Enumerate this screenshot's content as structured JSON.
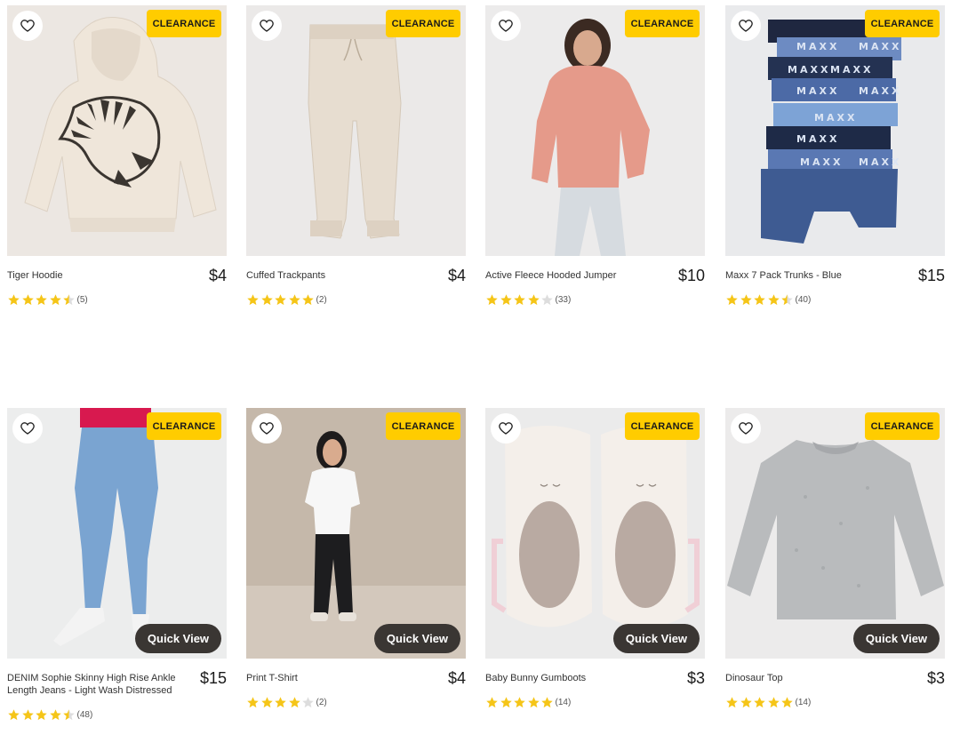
{
  "badge_label": "CLEARANCE",
  "quick_view_label": "Quick View",
  "colors": {
    "badge": "#ffcc00",
    "star": "#f5c518",
    "quick_view": "#3a3633"
  },
  "products": [
    {
      "name": "Tiger Hoodie",
      "price": "$4",
      "rating": 4.5,
      "count": "(5)",
      "quick_view": false
    },
    {
      "name": "Cuffed Trackpants",
      "price": "$4",
      "rating": 5,
      "count": "(2)",
      "quick_view": false
    },
    {
      "name": "Active Fleece Hooded Jumper",
      "price": "$10",
      "rating": 4,
      "count": "(33)",
      "quick_view": false
    },
    {
      "name": "Maxx 7 Pack Trunks - Blue",
      "price": "$15",
      "rating": 4.5,
      "count": "(40)",
      "quick_view": false
    },
    {
      "name": "DENIM Sophie Skinny High Rise Ankle Length Jeans - Light Wash Distressed",
      "price": "$15",
      "rating": 4.5,
      "count": "(48)",
      "quick_view": true
    },
    {
      "name": "Print T-Shirt",
      "price": "$4",
      "rating": 4,
      "count": "(2)",
      "quick_view": true
    },
    {
      "name": "Baby Bunny Gumboots",
      "price": "$3",
      "rating": 5,
      "count": "(14)",
      "quick_view": true
    },
    {
      "name": "Dinosaur Top",
      "price": "$3",
      "rating": 5,
      "count": "(14)",
      "quick_view": true
    }
  ]
}
